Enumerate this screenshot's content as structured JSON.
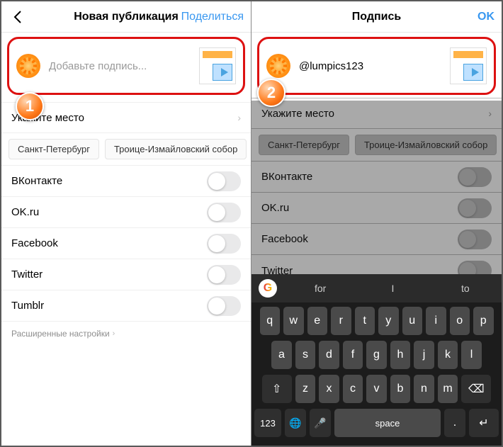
{
  "left": {
    "header": {
      "title": "Новая публикация",
      "action": "Поделиться"
    },
    "caption_placeholder": "Добавьте подпись...",
    "location_label": "Укажите место",
    "chips": [
      "Санкт-Петербург",
      "Троице-Измайловский собор"
    ],
    "networks": [
      {
        "name": "ВКонтакте"
      },
      {
        "name": "OK.ru"
      },
      {
        "name": "Facebook"
      },
      {
        "name": "Twitter"
      },
      {
        "name": "Tumblr"
      }
    ],
    "advanced": "Расширенные настройки"
  },
  "right": {
    "header": {
      "title": "Подпись",
      "action": "OK"
    },
    "caption_value": "@lumpics123",
    "location_label": "Укажите место",
    "chips": [
      "Санкт-Петербург",
      "Троице-Измайловский собор"
    ],
    "networks": [
      {
        "name": "ВКонтакте"
      },
      {
        "name": "OK.ru"
      },
      {
        "name": "Facebook"
      },
      {
        "name": "Twitter"
      }
    ]
  },
  "keyboard": {
    "suggestions": [
      "for",
      "I",
      "to"
    ],
    "row1": [
      "q",
      "w",
      "e",
      "r",
      "t",
      "y",
      "u",
      "i",
      "o",
      "p"
    ],
    "row2": [
      "a",
      "s",
      "d",
      "f",
      "g",
      "h",
      "j",
      "k",
      "l"
    ],
    "row3": [
      "z",
      "x",
      "c",
      "v",
      "b",
      "n",
      "m"
    ],
    "shift": "⇧",
    "backspace": "⌫",
    "numkey": "123",
    "globe": "🌐",
    "mic": "🎤",
    "space": "space",
    "period": ".",
    "enter": "↵"
  },
  "badges": {
    "one": "1",
    "two": "2"
  }
}
